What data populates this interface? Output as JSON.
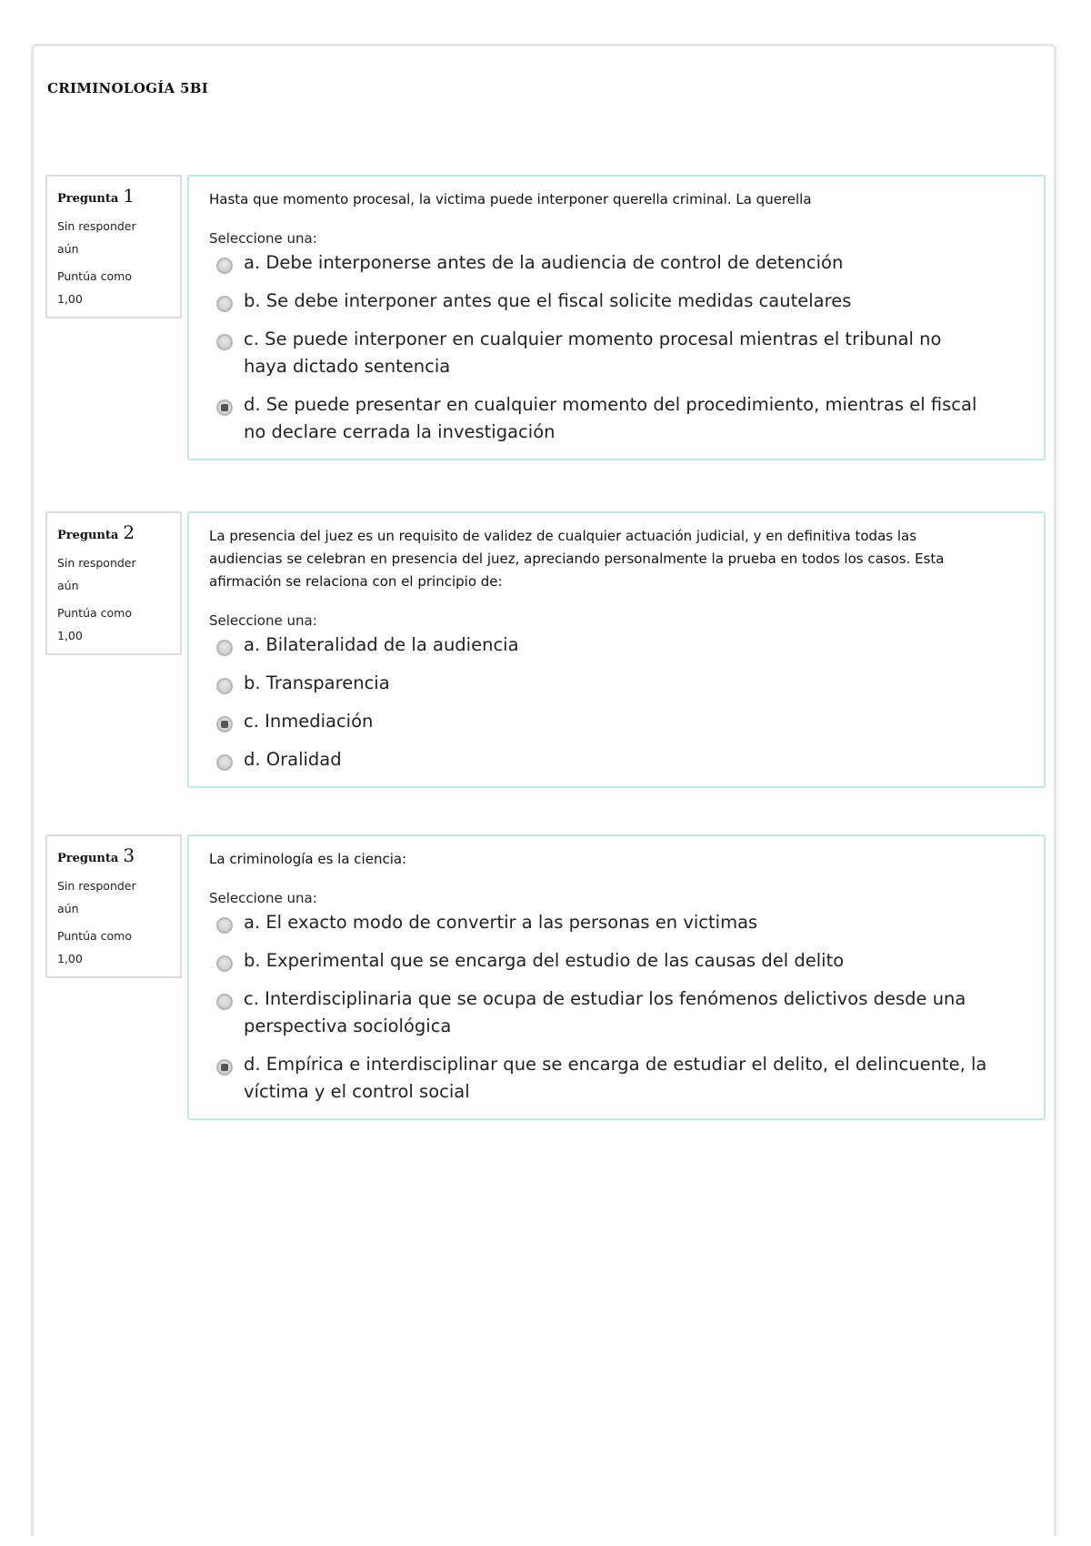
{
  "quiz": {
    "title": "CRIMINOLOGÍA 5BI"
  },
  "questions": [
    {
      "label": "Pregunta",
      "number": "1",
      "status": "Sin responder aún",
      "score_label": "Puntúa como",
      "score": "1,00",
      "text": "Hasta que momento procesal, la victima puede interponer querella criminal. La querella",
      "prompt": "Seleccione una:",
      "selected": "d",
      "answers": [
        {
          "key": "a",
          "text": "a. Debe interponerse antes de la audiencia de control de detención"
        },
        {
          "key": "b",
          "text": "b. Se debe interponer antes que el fiscal solicite medidas cautelares"
        },
        {
          "key": "c",
          "text": "c. Se puede interponer en cualquier momento procesal mientras el tribunal no haya dictado sentencia"
        },
        {
          "key": "d",
          "text": "d. Se puede presentar en cualquier momento del procedimiento, mientras el fiscal no declare cerrada la investigación"
        }
      ]
    },
    {
      "label": "Pregunta",
      "number": "2",
      "status": "Sin responder aún",
      "score_label": "Puntúa como",
      "score": "1,00",
      "text": "La presencia del juez es un requisito de validez de cualquier actuación judicial, y en definitiva todas las audiencias se celebran en presencia del juez, apreciando personalmente la prueba en todos los casos. Esta afirmación se relaciona con el principio de:",
      "prompt": "Seleccione una:",
      "selected": "c",
      "answers": [
        {
          "key": "a",
          "text": "a. Bilateralidad de la audiencia"
        },
        {
          "key": "b",
          "text": "b. Transparencia"
        },
        {
          "key": "c",
          "text": "c. Inmediación"
        },
        {
          "key": "d",
          "text": "d. Oralidad"
        }
      ]
    },
    {
      "label": "Pregunta",
      "number": "3",
      "status": "Sin responder aún",
      "score_label": "Puntúa como",
      "score": "1,00",
      "text": "La criminología es la ciencia:",
      "prompt": "Seleccione una:",
      "selected": "d",
      "answers": [
        {
          "key": "a",
          "text": "a. El exacto modo de convertir a las personas en victimas"
        },
        {
          "key": "b",
          "text": "b. Experimental que se encarga del estudio de las causas del delito"
        },
        {
          "key": "c",
          "text": "c. Interdisciplinaria que se ocupa de estudiar los fenómenos delictivos desde una perspectiva sociológica"
        },
        {
          "key": "d",
          "text": "d. Empírica e interdisciplinar que se encarga de estudiar el delito, el delincuente, la víctima y el control social"
        }
      ]
    }
  ],
  "colors": {
    "content_border": "#bfe6ef",
    "info_border": "#dddddd",
    "outer_border": "#e6e6e6"
  }
}
